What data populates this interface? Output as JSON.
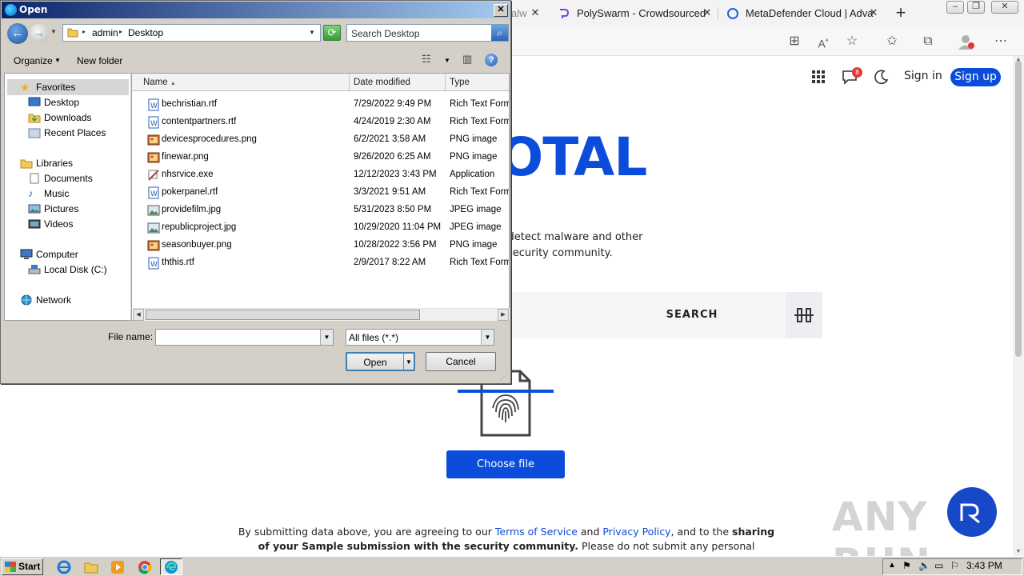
{
  "browser": {
    "tabs": [
      {
        "label": "alw"
      },
      {
        "label": "PolySwarm - Crowdsourced"
      },
      {
        "label": "MetaDefender Cloud | Adva"
      }
    ],
    "header": {
      "badge_count": "8",
      "signin_label": "Sign in",
      "signup_label": "Sign up"
    },
    "hero": {
      "logo_text": "USTOTAL",
      "desc_line1": "nd URLs to detect malware and other",
      "desc_line2": "m with the security community."
    },
    "search": {
      "button_label": "SEARCH"
    },
    "upload": {
      "button_label": "Choose file"
    },
    "footer": {
      "line1_pre": "By submitting data above, you are agreeing to our ",
      "terms": "Terms of Service",
      "and": " and ",
      "privacy": "Privacy Policy",
      "line1_post": ", and to the ",
      "sharing": "sharing",
      "line2_bold": "of your Sample submission with the security community.",
      "line2_rest": " Please do not submit any personal"
    },
    "watermark": "ANY RUN"
  },
  "dialog": {
    "title": "Open",
    "address": {
      "crumb1": "admin",
      "crumb2": "Desktop"
    },
    "search_placeholder": "Search Desktop",
    "commands": {
      "organize": "Organize",
      "new_folder": "New folder"
    },
    "nav": {
      "favorites": "Favorites",
      "desktop": "Desktop",
      "downloads": "Downloads",
      "recent": "Recent Places",
      "libraries": "Libraries",
      "documents": "Documents",
      "music": "Music",
      "pictures": "Pictures",
      "videos": "Videos",
      "computer": "Computer",
      "local_disk": "Local Disk (C:)",
      "network": "Network"
    },
    "columns": {
      "name": "Name",
      "date": "Date modified",
      "type": "Type"
    },
    "files": [
      {
        "name": "bechristian.rtf",
        "date": "7/29/2022 9:49 PM",
        "type": "Rich Text Format",
        "icon": "rtf-icon"
      },
      {
        "name": "contentpartners.rtf",
        "date": "4/24/2019 2:30 AM",
        "type": "Rich Text Format",
        "icon": "rtf-icon"
      },
      {
        "name": "devicesprocedures.png",
        "date": "6/2/2021 3:58 AM",
        "type": "PNG image",
        "icon": "png-icon"
      },
      {
        "name": "finewar.png",
        "date": "9/26/2020 6:25 AM",
        "type": "PNG image",
        "icon": "png-icon"
      },
      {
        "name": "nhsrvice.exe",
        "date": "12/12/2023 3:43 PM",
        "type": "Application",
        "icon": "exe-icon"
      },
      {
        "name": "pokerpanel.rtf",
        "date": "3/3/2021 9:51 AM",
        "type": "Rich Text Format",
        "icon": "rtf-icon"
      },
      {
        "name": "providefilm.jpg",
        "date": "5/31/2023 8:50 PM",
        "type": "JPEG image",
        "icon": "jpg-icon"
      },
      {
        "name": "republicproject.jpg",
        "date": "10/29/2020 11:04 PM",
        "type": "JPEG image",
        "icon": "jpg-icon"
      },
      {
        "name": "seasonbuyer.png",
        "date": "10/28/2022 3:56 PM",
        "type": "PNG image",
        "icon": "png-icon"
      },
      {
        "name": "ththis.rtf",
        "date": "2/9/2017 8:22 AM",
        "type": "Rich Text Format",
        "icon": "rtf-icon"
      }
    ],
    "filename_label": "File name:",
    "filename_value": "",
    "filetype_value": "All files (*.*)",
    "open_label": "Open",
    "cancel_label": "Cancel"
  },
  "taskbar": {
    "start_label": "Start",
    "clock": "3:43 PM"
  },
  "colors": {
    "brand_blue": "#0b4dda",
    "dialog_face": "#d4d0c8",
    "title_start": "#0a246a",
    "title_end": "#a6caf0"
  }
}
